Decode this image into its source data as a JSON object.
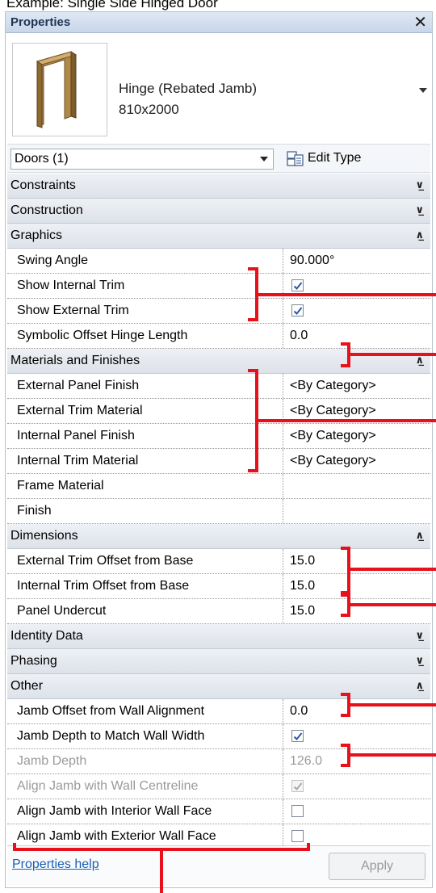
{
  "caption": "Example: Single Side Hinged Door",
  "panel": {
    "title": "Properties",
    "close_glyph": "✕"
  },
  "type_selector": {
    "name_line1": "Hinge (Rebated Jamb)",
    "name_line2": "810x2000"
  },
  "filter": {
    "value": "Doors (1)",
    "edit_type_label": "Edit Type"
  },
  "groups": {
    "constraints": "Constraints",
    "construction": "Construction",
    "graphics": "Graphics",
    "materials": "Materials and Finishes",
    "dimensions": "Dimensions",
    "identity": "Identity Data",
    "phasing": "Phasing",
    "other": "Other"
  },
  "props": {
    "swing_angle": {
      "name": "Swing Angle",
      "value": "90.000°"
    },
    "show_internal_trim": {
      "name": "Show Internal Trim",
      "checked": true
    },
    "show_external_trim": {
      "name": "Show External Trim",
      "checked": true
    },
    "symbolic_offset": {
      "name": "Symbolic Offset Hinge Length",
      "value": "0.0"
    },
    "ext_panel_finish": {
      "name": "External Panel Finish",
      "value": "<By Category>"
    },
    "ext_trim_material": {
      "name": "External Trim Material",
      "value": "<By Category>"
    },
    "int_panel_finish": {
      "name": "Internal Panel Finish",
      "value": "<By Category>"
    },
    "int_trim_material": {
      "name": "Internal Trim Material",
      "value": "<By Category>"
    },
    "frame_material": {
      "name": "Frame Material",
      "value": ""
    },
    "finish": {
      "name": "Finish",
      "value": ""
    },
    "ext_trim_offset": {
      "name": "External Trim Offset from Base",
      "value": "15.0"
    },
    "int_trim_offset": {
      "name": "Internal Trim Offset from Base",
      "value": "15.0"
    },
    "panel_undercut": {
      "name": "Panel Undercut",
      "value": "15.0"
    },
    "jamb_offset": {
      "name": "Jamb Offset from Wall Alignment",
      "value": "0.0"
    },
    "jamb_depth_match": {
      "name": "Jamb Depth to Match Wall Width",
      "checked": true
    },
    "jamb_depth": {
      "name": "Jamb Depth",
      "value": "126.0"
    },
    "align_centreline": {
      "name": "Align Jamb with Wall Centreline",
      "checked": true
    },
    "align_interior": {
      "name": "Align Jamb with Interior Wall Face",
      "checked": false
    },
    "align_exterior": {
      "name": "Align Jamb with Exterior Wall Face",
      "checked": false
    }
  },
  "footer": {
    "help_label": "Properties help",
    "apply_label": "Apply"
  },
  "colors": {
    "annotation": "#e8101a",
    "title_bar": "#c8d6ea",
    "link": "#1a5fb4"
  },
  "icons": {
    "collapsed": "chevron-double-down-icon",
    "expanded": "chevron-double-up-icon",
    "edit_type": "edit-type-icon",
    "thumbnail": "door-frame-thumbnail"
  }
}
